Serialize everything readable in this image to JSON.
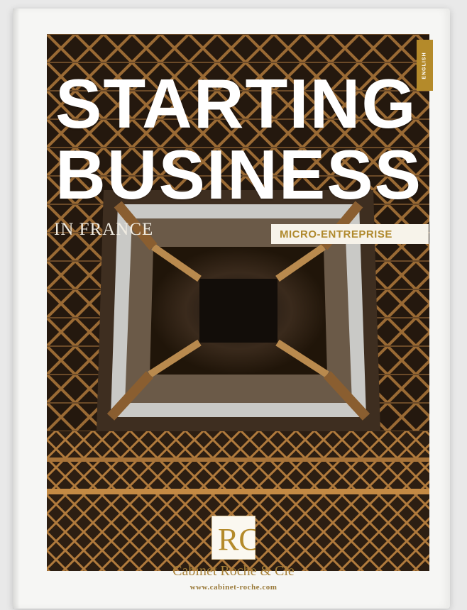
{
  "cover": {
    "title_line1": "STARTING",
    "title_line2": "BUSINESS",
    "subtitle": "IN FRANCE",
    "badge": "MICRO-ENTREPRISE",
    "language_tab": "ENGLISH",
    "logo_text": "RC",
    "publisher": "Cabinet Roche & Cie",
    "website": "www.cabinet-roche.com"
  },
  "colors": {
    "gold": "#b48a2a",
    "photo_dark": "#2a1d12",
    "title_white": "#ffffff"
  }
}
